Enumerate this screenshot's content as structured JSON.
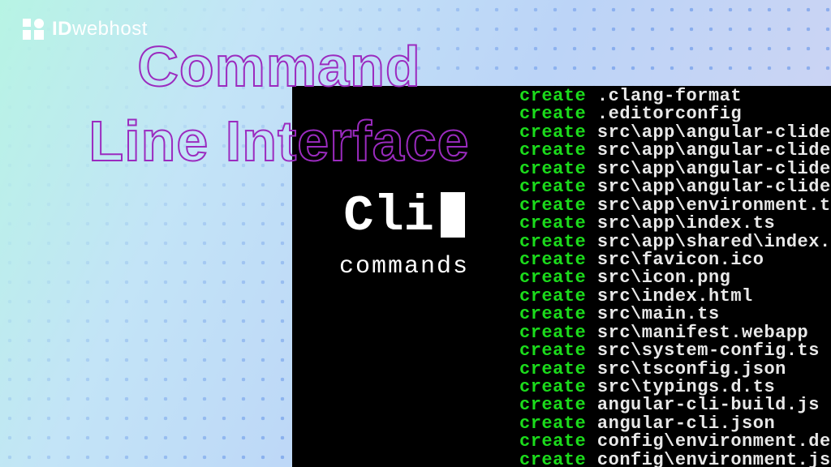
{
  "logo": {
    "bold": "ID",
    "rest": "webhost"
  },
  "headline": "Command\nLine Interface",
  "overlay": {
    "cli": "Cli",
    "commands": "commands"
  },
  "terminal": {
    "keyword": "create",
    "rows": [
      ".clang-format",
      ".editorconfig",
      "src\\app\\angular-clidemo-",
      "src\\app\\angular-clidemo-",
      "src\\app\\angular-clidemo-",
      "src\\app\\angular-clidemo-",
      "src\\app\\environment.ts",
      "src\\app\\index.ts",
      "src\\app\\shared\\index.ts",
      "src\\favicon.ico",
      "src\\icon.png",
      "src\\index.html",
      "src\\main.ts",
      "src\\manifest.webapp",
      "src\\system-config.ts",
      "src\\tsconfig.json",
      "src\\typings.d.ts",
      "angular-cli-build.js",
      "angular-cli.json",
      "config\\environment.dev.t",
      "config\\environment.js"
    ]
  }
}
